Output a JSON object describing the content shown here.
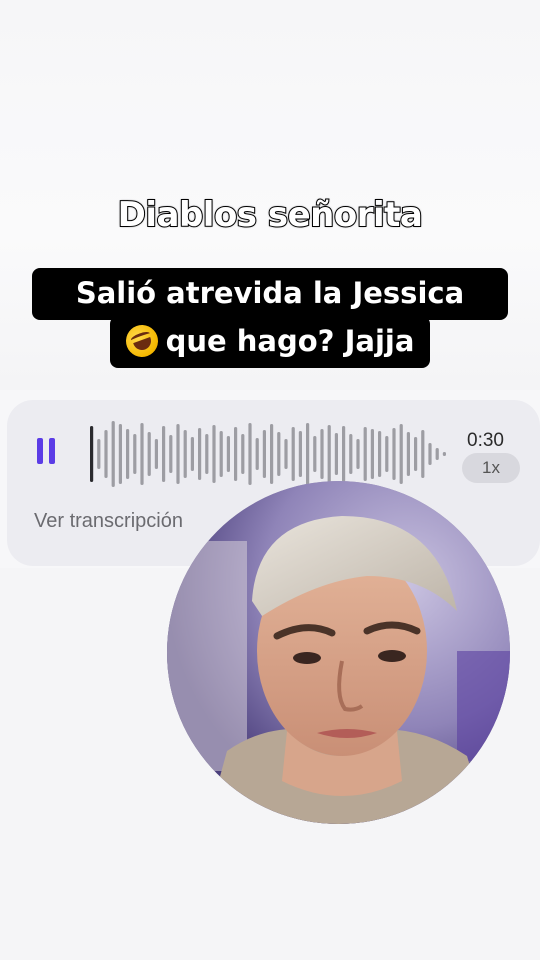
{
  "captions": {
    "title": "Diablos señorita",
    "line1": "Salió atrevida la Jessica",
    "line2_emoji": "rolling-on-floor-laughing-emoji",
    "line2_text": "que hago? Jajja"
  },
  "voice_message": {
    "duration": "0:30",
    "speed": "1x",
    "transcript_link": "Ver transcripción",
    "state": "playing",
    "accent_color": "#5b3ce6",
    "play_pause_icon": "pause-icon",
    "progress_fraction": 0.02
  },
  "video_note": {
    "subject": "person-portrait",
    "shape": "circle"
  },
  "colors": {
    "card_bg": "#ececf1",
    "waveform": "#9d9da3",
    "caption_bg": "#000000"
  }
}
